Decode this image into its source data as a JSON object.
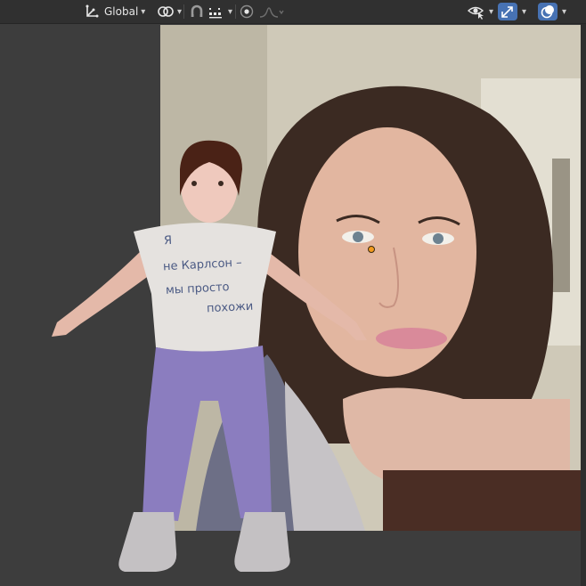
{
  "header": {
    "orientation": {
      "icon": "transform-orientation-icon",
      "label": "Global"
    },
    "pivot": {
      "icon": "pivot-point-icon"
    },
    "snap": {
      "icon": "snap-magnet-icon",
      "mode_icon": "snap-increment-icon"
    },
    "proportional": {
      "icon": "proportional-editing-icon",
      "falloff_icon": "falloff-curve-icon"
    },
    "visibility": {
      "icon": "selectability-visibility-icon"
    },
    "gizmo": {
      "icon": "gizmo-icon"
    },
    "overlays": {
      "icon": "overlays-icon"
    }
  },
  "viewport": {
    "reference_image": "photo-reference",
    "character": "stylized-character",
    "tshirt_text": {
      "line1": "Я",
      "line2": "не Карлсон –",
      "line3": "мы просто",
      "line4": "похожи"
    }
  },
  "colors": {
    "header_bg": "#303030",
    "viewport_bg": "#3d3d3d",
    "active_blue": "#4772b3",
    "origin_orange": "#f29a1e"
  }
}
